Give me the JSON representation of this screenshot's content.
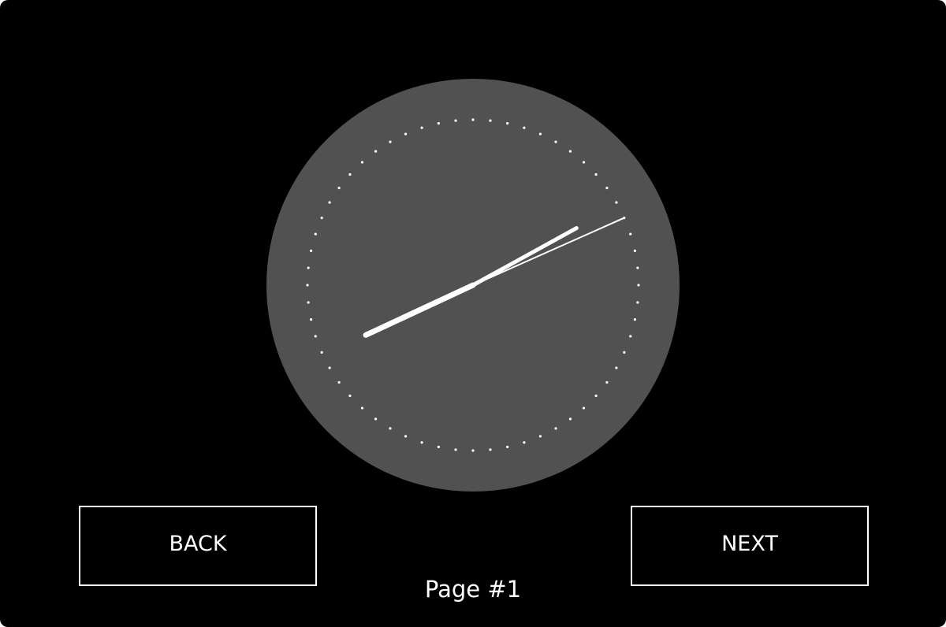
{
  "clock": {
    "face_color": "#515151",
    "mark_color": "#ffffff",
    "minute_marks": 60,
    "time": {
      "hour": 8,
      "minute": 10,
      "second": 11
    }
  },
  "navigation": {
    "back_label": "BACK",
    "next_label": "NEXT",
    "page_label": "Page #1"
  }
}
